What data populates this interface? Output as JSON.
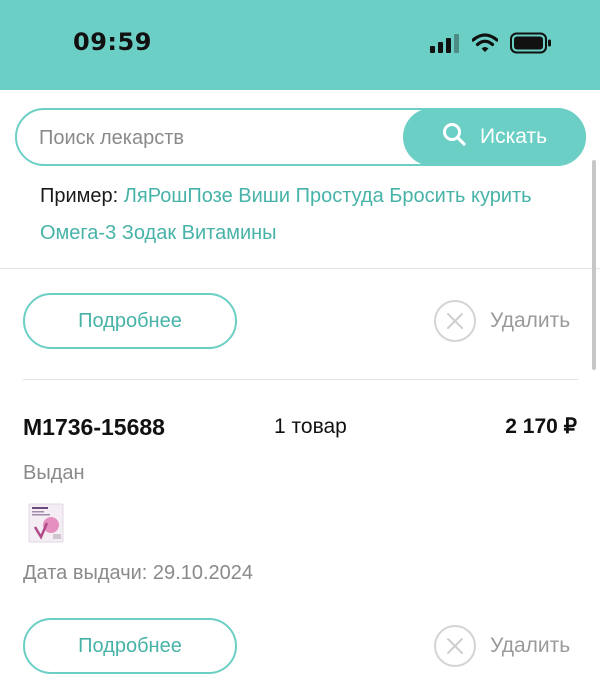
{
  "status_bar": {
    "time": "09:59"
  },
  "search": {
    "placeholder": "Поиск лекарств",
    "button_label": "Искать"
  },
  "examples": {
    "label": "Пример:",
    "items": [
      "ЛяРошПозе",
      "Виши",
      "Простуда",
      "Бросить курить",
      "Омега-3",
      "Зодак",
      "Витамины"
    ]
  },
  "orders": [
    {
      "details_label": "Подробнее",
      "delete_label": "Удалить"
    },
    {
      "id": "M1736-15688",
      "count": "1 товар",
      "total": "2 170 ₽",
      "status": "Выдан",
      "date": "Дата выдачи: 29.10.2024",
      "details_label": "Подробнее",
      "delete_label": "Удалить"
    }
  ],
  "colors": {
    "accent": "#6ccfc5",
    "link": "#47b3a8",
    "muted": "#8a8a8a"
  }
}
